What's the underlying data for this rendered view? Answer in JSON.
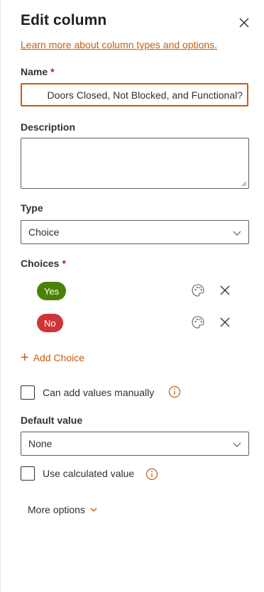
{
  "header": {
    "title": "Edit column",
    "learn_more": "Learn more about column types and options."
  },
  "name": {
    "label": "Name",
    "required_mark": "*",
    "value": "Doors Closed, Not Blocked, and Functional?"
  },
  "description": {
    "label": "Description",
    "value": ""
  },
  "type": {
    "label": "Type",
    "value": "Choice"
  },
  "choices": {
    "label": "Choices",
    "required_mark": "*",
    "items": [
      {
        "label": "Yes",
        "color": "#498205"
      },
      {
        "label": "No",
        "color": "#d13438"
      }
    ],
    "add_label": "Add Choice"
  },
  "manual_values": {
    "label": "Can add values manually"
  },
  "default_value": {
    "label": "Default value",
    "value": "None"
  },
  "calculated": {
    "label": "Use calculated value"
  },
  "more_options": {
    "label": "More options"
  },
  "colors": {
    "accent": "#c75d10",
    "required": "#a4262c"
  },
  "icons": [
    "close-icon",
    "chevron-down-icon",
    "palette-icon",
    "remove-icon",
    "plus-icon",
    "info-icon"
  ]
}
